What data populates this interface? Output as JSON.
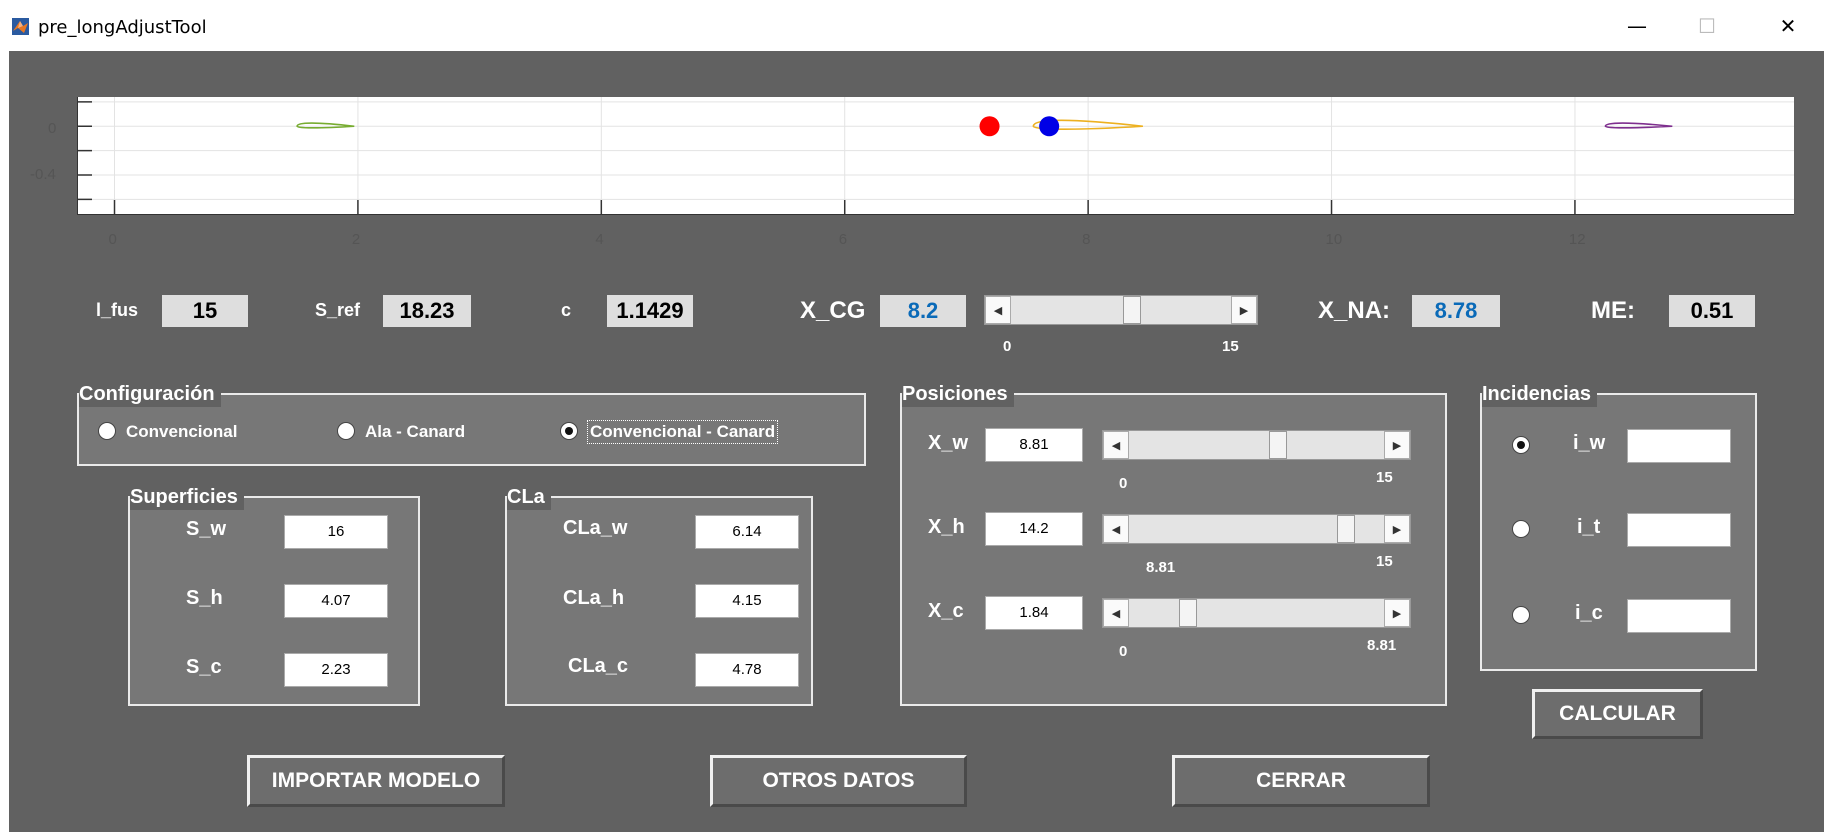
{
  "window": {
    "title": "pre_longAdjustTool",
    "minimize": "—",
    "maximize": "☐",
    "close": "✕"
  },
  "plot": {
    "yticks": [
      "0",
      "-0.4"
    ],
    "xticks": [
      "0",
      "2",
      "4",
      "6",
      "8",
      "10",
      "12"
    ],
    "xlim": [
      -0.3,
      13.8
    ],
    "ylim": [
      -0.72,
      0.24
    ],
    "grid": true,
    "cg_marker_color": "#ff0000",
    "na_marker_color": "#0000e6",
    "airfoil_colors": {
      "canard": "#77ac30",
      "wing": "#edb120",
      "tail": "#7e2f8e"
    }
  },
  "top": {
    "l_fus_label": "l_fus",
    "l_fus_value": "15",
    "s_ref_label": "S_ref",
    "s_ref_value": "18.23",
    "c_label": "c",
    "c_value": "1.1429",
    "xcg_label": "X_CG",
    "xcg_value": "8.2",
    "xcg_slider": {
      "min_label": "0",
      "max_label": "15",
      "value": 8.2,
      "min": 0,
      "max": 15
    },
    "xna_label": "X_NA:",
    "xna_value": "8.78",
    "me_label": "ME:",
    "me_value": "0.51"
  },
  "config": {
    "title": "Configuración",
    "options": [
      "Convencional",
      "Ala - Canard",
      "Convencional - Canard"
    ],
    "selected": "Convencional - Canard"
  },
  "superficies": {
    "title": "Superficies",
    "labels": [
      "S_w",
      "S_h",
      "S_c"
    ],
    "values": [
      "16",
      "4.07",
      "2.23"
    ]
  },
  "cla": {
    "title": "CLa",
    "labels": [
      "CLa_w",
      "CLa_h",
      "CLa_c"
    ],
    "values": [
      "6.14",
      "4.15",
      "4.78"
    ]
  },
  "posiciones": {
    "title": "Posiciones",
    "rows": [
      {
        "label": "X_w",
        "value": "8.81",
        "min_label": "0",
        "max_label": "15",
        "pos": 0.5873
      },
      {
        "label": "X_h",
        "value": "14.2",
        "min_label": "8.81",
        "max_label": "15",
        "pos": 0.8708
      },
      {
        "label": "X_c",
        "value": "1.84",
        "min_label": "0",
        "max_label": "8.81",
        "pos": 0.2089
      }
    ]
  },
  "incidencias": {
    "title": "Incidencias",
    "labels": [
      "i_w",
      "i_t",
      "i_c"
    ],
    "values": [
      "",
      "",
      ""
    ],
    "selected": "i_w"
  },
  "buttons": {
    "calcular": "CALCULAR",
    "importar": "IMPORTAR MODELO",
    "otros": "OTROS DATOS",
    "cerrar": "CERRAR"
  }
}
